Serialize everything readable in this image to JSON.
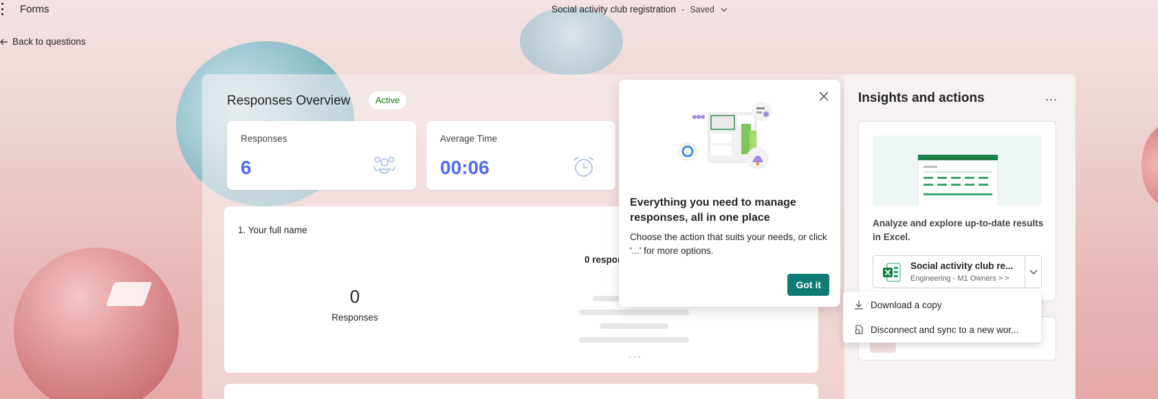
{
  "app": {
    "name": "Forms",
    "doc_title": "Social activity club registration",
    "separator": "-",
    "save_status": "Saved"
  },
  "nav": {
    "back_label": "Back to questions"
  },
  "overview": {
    "title": "Responses Overview",
    "status_badge": "Active",
    "stats": [
      {
        "label": "Responses",
        "value": "6",
        "icon": "people-icon"
      },
      {
        "label": "Average Time",
        "value": "00:06",
        "icon": "alarm-clock-icon"
      }
    ]
  },
  "question": {
    "title": "1. Your full name",
    "count": "0",
    "count_label": "Responses",
    "responses_header": "0 respon"
  },
  "popup": {
    "heading": "Everything you need to manage responses, all in one place",
    "body": "Choose the action that suits your needs, or click '...' for more options.",
    "button": "Got it"
  },
  "insights": {
    "title": "Insights and actions",
    "more_label": "...",
    "excel_desc": "Analyze and explore up-to-date results in Excel.",
    "file_name": "Social activity club re...",
    "file_path": "Engineering - M1 Owners > >"
  },
  "menu": {
    "items": [
      {
        "label": "Download a copy",
        "icon": "download-icon"
      },
      {
        "label": "Disconnect and sync to a new wor...",
        "icon": "disconnect-sync-icon"
      }
    ]
  },
  "colors": {
    "accent_blue": "#4f6bed",
    "active_green": "#107c10",
    "button_teal": "#0e7a75",
    "excel_green": "#107c41"
  }
}
